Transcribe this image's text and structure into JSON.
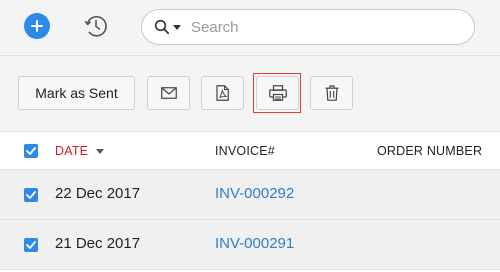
{
  "header": {
    "add_icon": "plus-icon",
    "history_icon": "history-icon",
    "search": {
      "placeholder": "Search",
      "value": "",
      "icon": "search-icon"
    }
  },
  "toolbar": {
    "mark_as_sent_label": "Mark as Sent",
    "email_icon": "envelope-icon",
    "pdf_icon": "pdf-icon",
    "print_icon": "printer-icon",
    "delete_icon": "trash-icon",
    "highlight_color": "#e23a3a"
  },
  "table": {
    "columns": [
      "DATE",
      "INVOICE#",
      "ORDER NUMBER"
    ],
    "sorted_column_color": "#d0202a",
    "select_all_checked": true,
    "rows": [
      {
        "date": "22 Dec 2017",
        "invoice": "INV-000292",
        "order_number": "",
        "checked": true
      },
      {
        "date": "21 Dec 2017",
        "invoice": "INV-000291",
        "order_number": "",
        "checked": true
      }
    ]
  },
  "colors": {
    "accent": "#2d8ae6",
    "link": "#2d7fc9"
  }
}
